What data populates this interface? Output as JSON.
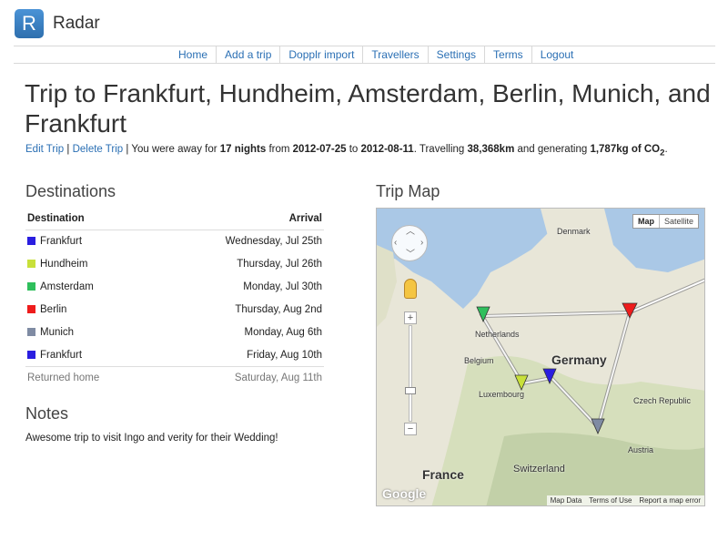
{
  "app": {
    "logo_letter": "R",
    "name": "Radar"
  },
  "nav": [
    "Home",
    "Add a trip",
    "Dopplr import",
    "Travellers",
    "Settings",
    "Terms",
    "Logout"
  ],
  "page": {
    "title": "Trip to Frankfurt, Hundheim, Amsterdam, Berlin, Munich, and Frankfurt",
    "edit_trip": "Edit Trip",
    "delete_trip": "Delete Trip",
    "away_prefix": "You were away for",
    "nights": "17 nights",
    "from_word": "from",
    "from_date": "2012-07-25",
    "to_word": "to",
    "to_date": "2012-08-11",
    "travelling_word": ". Travelling",
    "distance": "38,368km",
    "generating_word": "and generating",
    "co2_amount": "1,787kg of CO",
    "co2_sub": "2"
  },
  "destinations": {
    "heading": "Destinations",
    "col_destination": "Destination",
    "col_arrival": "Arrival",
    "rows": [
      {
        "name": "Frankfurt",
        "arrival": "Wednesday, Jul 25th",
        "color": "#2a1ee0"
      },
      {
        "name": "Hundheim",
        "arrival": "Thursday, Jul 26th",
        "color": "#c8e03a"
      },
      {
        "name": "Amsterdam",
        "arrival": "Monday, Jul 30th",
        "color": "#2fbf5c"
      },
      {
        "name": "Berlin",
        "arrival": "Thursday, Aug 2nd",
        "color": "#ee1c1c"
      },
      {
        "name": "Munich",
        "arrival": "Monday, Aug 6th",
        "color": "#7f8ba3"
      },
      {
        "name": "Frankfurt",
        "arrival": "Friday, Aug 10th",
        "color": "#2a1ee0"
      }
    ],
    "returned_label": "Returned home",
    "returned_date": "Saturday, Aug 11th"
  },
  "notes": {
    "heading": "Notes",
    "text": "Awesome trip to visit Ingo and verity for their Wedding!"
  },
  "map": {
    "heading": "Trip Map",
    "type_map": "Map",
    "type_satellite": "Satellite",
    "labels": {
      "denmark": "Denmark",
      "netherlands": "Netherlands",
      "belgium": "Belgium",
      "germany": "Germany",
      "luxembourg": "Luxembourg",
      "czech": "Czech Republic",
      "austria": "Austria",
      "switzerland": "Switzerland",
      "france": "France"
    },
    "footer": [
      "Map Data",
      "Terms of Use",
      "Report a map error"
    ],
    "google": "Google",
    "zoom_in": "+",
    "zoom_out": "−"
  }
}
